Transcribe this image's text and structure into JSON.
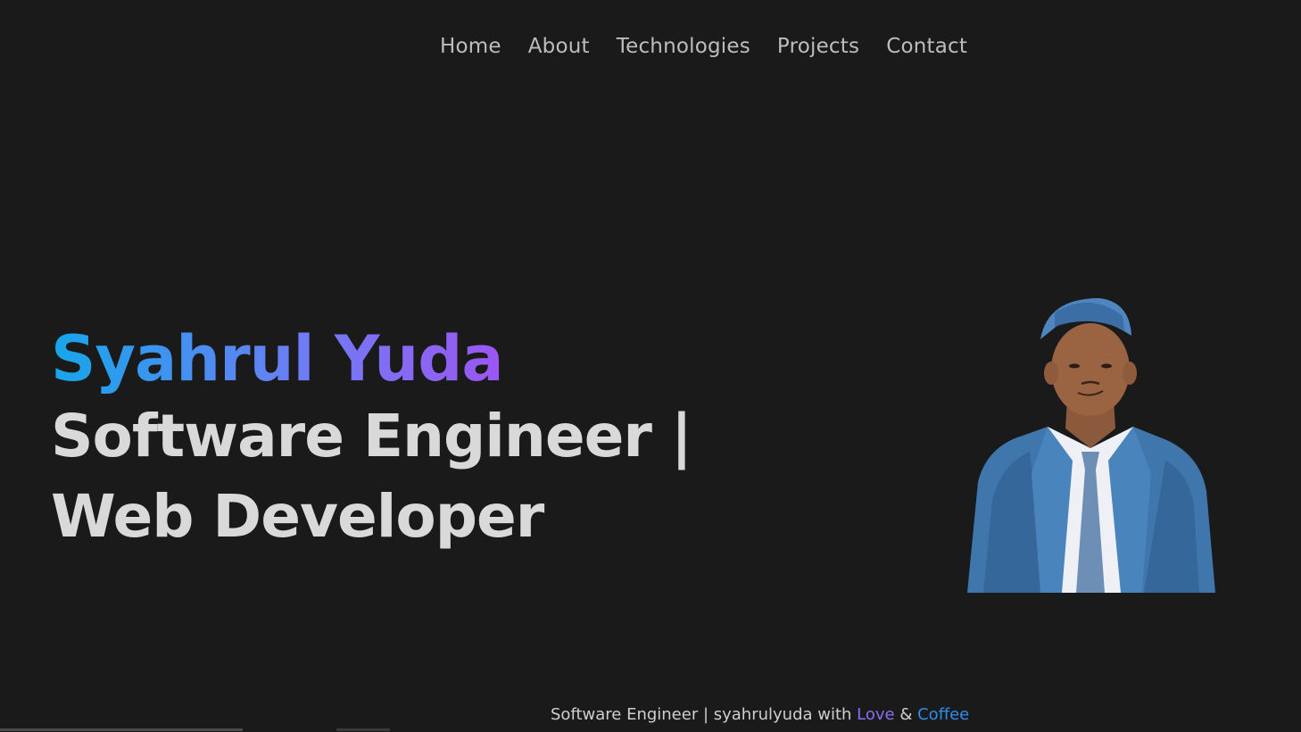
{
  "nav": {
    "items": [
      {
        "label": "Home"
      },
      {
        "label": "About"
      },
      {
        "label": "Technologies"
      },
      {
        "label": "Projects"
      },
      {
        "label": "Contact"
      }
    ]
  },
  "hero": {
    "name": "Syahrul Yuda",
    "role_line1": "Software Engineer |",
    "role_line2": "Web Developer"
  },
  "portrait": {
    "icon": "portrait-photo"
  },
  "footer": {
    "prefix": "Software Engineer | syahrulyuda with ",
    "love": "Love",
    "amp": " & ",
    "coffee": "Coffee"
  },
  "colors": {
    "background": "#1a1a1b",
    "nav_text": "#bdbdbd",
    "name_gradient_start": "#17a6ea",
    "name_gradient_end": "#b344e6",
    "role_text": "#d9d9d9",
    "jacket_blue": "#3f77ad"
  }
}
